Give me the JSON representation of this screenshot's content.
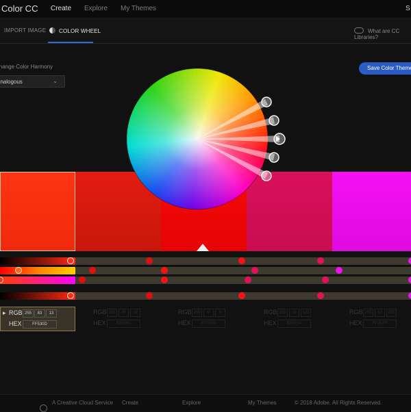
{
  "app": {
    "title": "Color CC",
    "nav": [
      "Create",
      "Explore",
      "My Themes"
    ],
    "user_initial": "S"
  },
  "subnav": {
    "tabs": [
      "IMPORT IMAGE",
      "COLOR WHEEL"
    ],
    "active_tab": "COLOR WHEEL",
    "cc_link": "What are CC Libraries?"
  },
  "harmony": {
    "label": "Change Color Harmony",
    "selected": "Analogous"
  },
  "save_button": "Save Color Theme",
  "colors": {
    "accent": "#2a5bc6",
    "swatches": [
      "#ff2f0d",
      "#e81c0c",
      "#ff0000",
      "#e0105a",
      "#ff00ff"
    ]
  },
  "swatches": [
    {
      "rgb": [
        "255",
        "83",
        "13"
      ],
      "hex": "FF530D",
      "selected": true
    },
    {
      "rgb": [
        "232",
        "49",
        "12"
      ],
      "hex": "E8310C",
      "selected": false
    },
    {
      "rgb": [
        "255",
        "0",
        "0"
      ],
      "hex": "FF0000",
      "selected": false
    },
    {
      "rgb": [
        "232",
        "12",
        "122"
      ],
      "hex": "E80C7A",
      "selected": false
    },
    {
      "rgb": [
        "255",
        "13",
        "255"
      ],
      "hex": "FF0DFF",
      "selected": false
    }
  ],
  "value_labels": {
    "rgb": "RGB",
    "hex": "HEX"
  },
  "footer": {
    "service": "A Creative Cloud Service",
    "create": "Create",
    "explore": "Explore",
    "my_themes": "My Themes",
    "copyright": "© 2018 Adobe. All Rights Reserved."
  }
}
